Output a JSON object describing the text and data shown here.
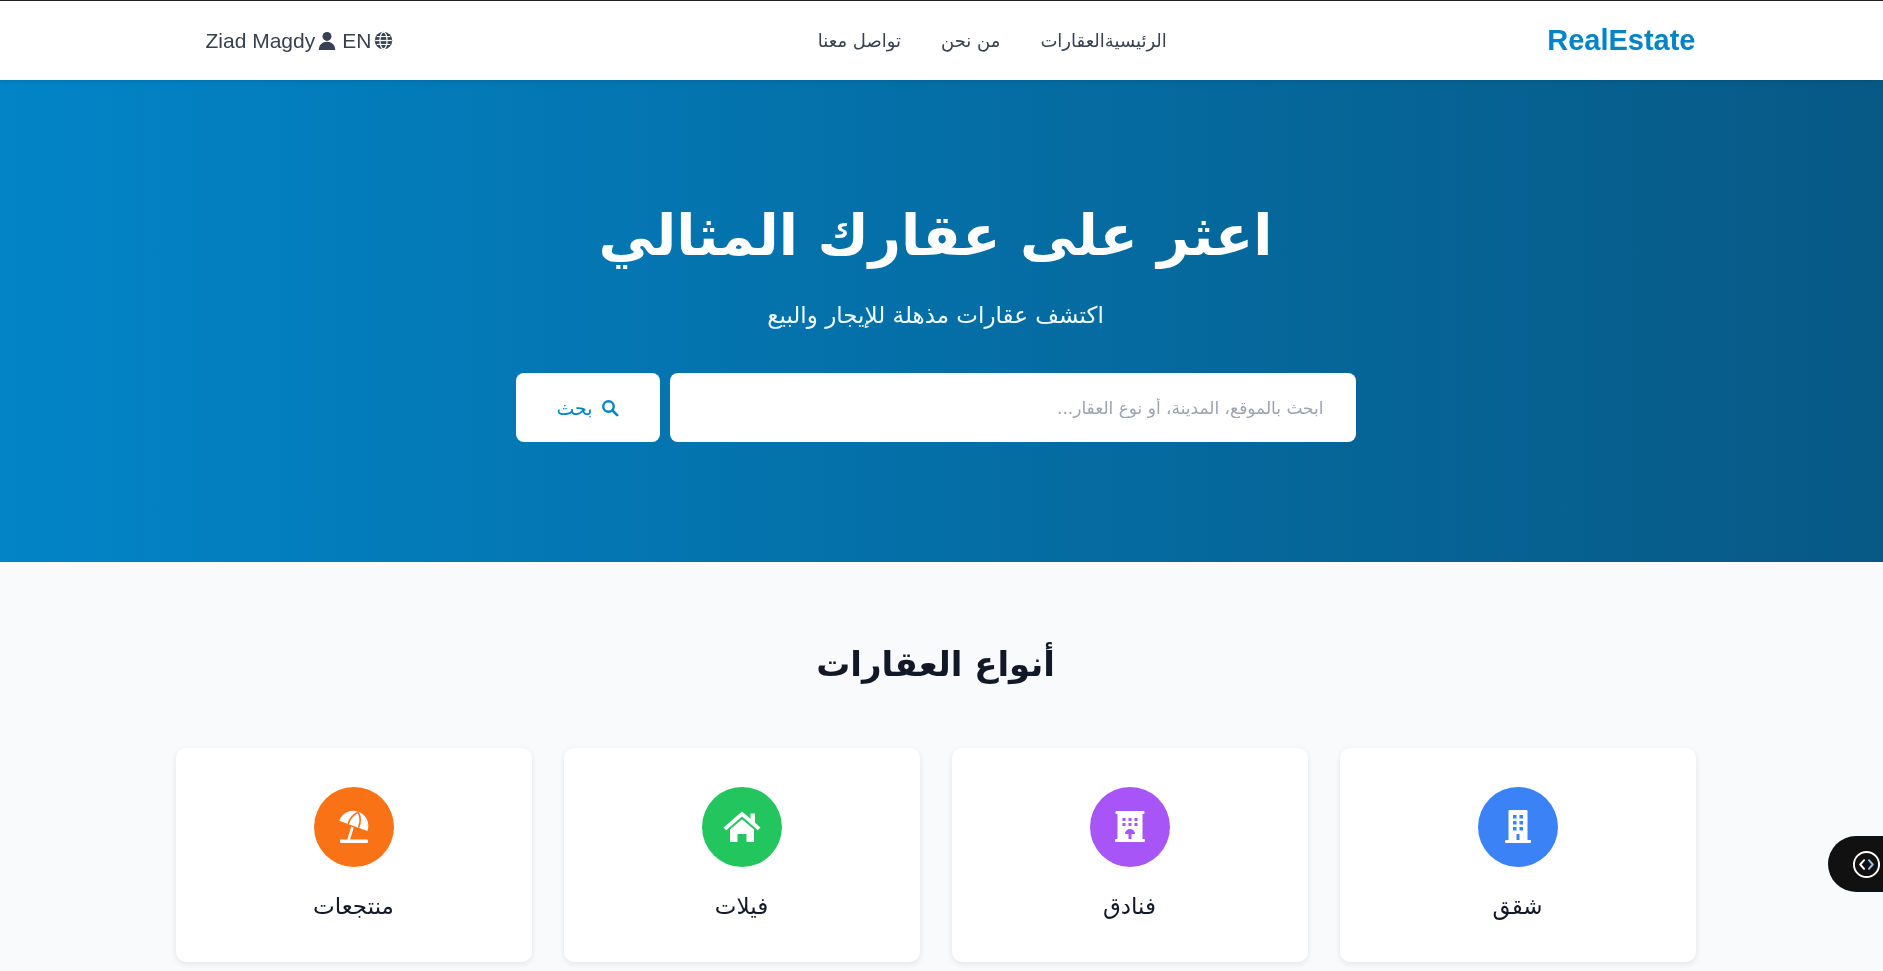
{
  "header": {
    "logo": "RealEstate",
    "nav": [
      "الرئيسية",
      "العقارات",
      "من نحن",
      "تواصل معنا"
    ],
    "user": "Ziad Magdy",
    "language": "EN"
  },
  "hero": {
    "title": "اعثر على عقارك المثالي",
    "subtitle": "اكتشف عقارات مذهلة للإيجار والبيع",
    "search": {
      "placeholder": "ابحث بالموقع، المدينة، أو نوع العقار...",
      "button": "بحث"
    }
  },
  "property_types": {
    "title": "أنواع العقارات",
    "items": [
      {
        "label": "شقق",
        "kind": "building",
        "color": "#3b82f6"
      },
      {
        "label": "فنادق",
        "kind": "hotel",
        "color": "#a855f7"
      },
      {
        "label": "فيلات",
        "kind": "house",
        "color": "#22c55e"
      },
      {
        "label": "منتجعات",
        "kind": "beach",
        "color": "#f97316"
      }
    ]
  }
}
